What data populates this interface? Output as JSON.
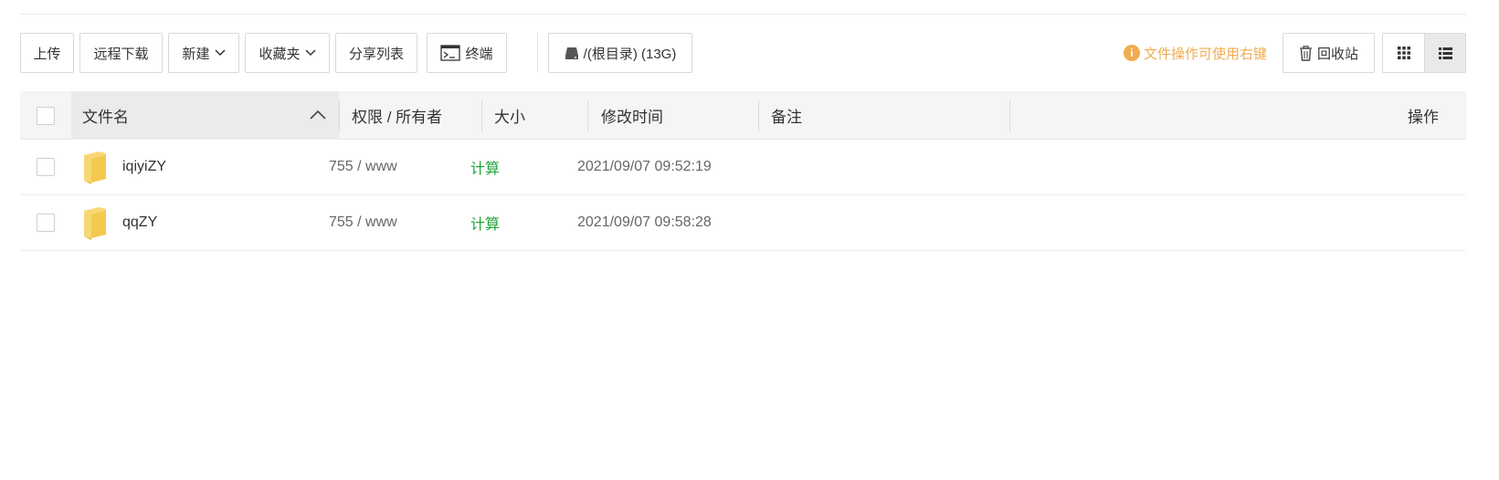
{
  "toolbar": {
    "upload": "上传",
    "remote_download": "远程下载",
    "new": "新建",
    "favorites": "收藏夹",
    "share_list": "分享列表",
    "terminal": "终端",
    "disk": "/(根目录) (13G)",
    "hint": "文件操作可使用右键",
    "recycle_bin": "回收站"
  },
  "table": {
    "headers": {
      "name": "文件名",
      "permission": "权限 / 所有者",
      "size": "大小",
      "modified": "修改时间",
      "remark": "备注",
      "actions": "操作"
    },
    "rows": [
      {
        "name": "iqiyiZY",
        "permission": "755 / www",
        "size": "计算",
        "modified": "2021/09/07 09:52:19",
        "remark": ""
      },
      {
        "name": "qqZY",
        "permission": "755 / www",
        "size": "计算",
        "modified": "2021/09/07 09:58:28",
        "remark": ""
      }
    ]
  },
  "colors": {
    "accent_green": "#20a53a",
    "hint_orange": "#f0ad4e",
    "folder_yellow": "#f7d774"
  },
  "icons": {
    "terminal": "terminal-icon",
    "disk": "hard-drive-icon",
    "hint": "info-icon",
    "recycle_bin": "trash-icon",
    "grid_view": "grid-view-icon",
    "list_view": "list-view-icon",
    "sort": "chevron-up-icon",
    "folder": "folder-icon"
  },
  "view_mode": "list"
}
